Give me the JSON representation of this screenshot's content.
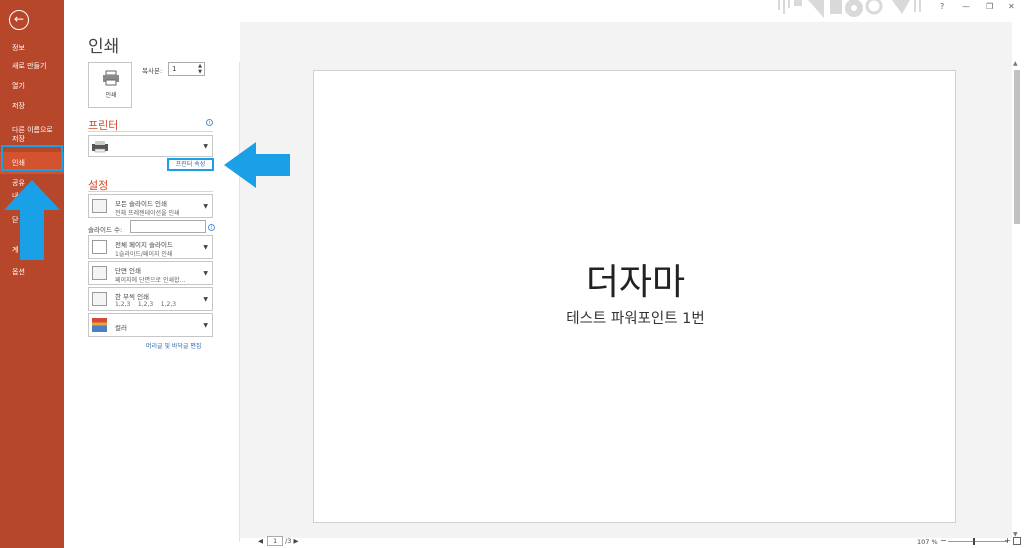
{
  "sidebar": {
    "back_icon": "back-arrow-icon",
    "items": [
      {
        "label": "정보"
      },
      {
        "label": "새로 만들기"
      },
      {
        "label": "열기"
      },
      {
        "label": "저장"
      },
      {
        "label": "다른 이름으로\n저장"
      },
      {
        "label": "인쇄",
        "selected": true
      },
      {
        "label": "공유"
      },
      {
        "label": "옵션"
      }
    ],
    "hidden_letters": [
      "내",
      "닫",
      "계"
    ]
  },
  "window": {
    "help": "?",
    "minimize": "—",
    "restore": "❐",
    "close": "✕"
  },
  "print": {
    "title": "인쇄",
    "print_button_label": "인쇄",
    "copies_label": "복사본:",
    "copies_value": "1",
    "printer_heading": "프린터",
    "printer_properties": "프린터 속성",
    "settings_heading": "설정",
    "settings": [
      {
        "main": "모든 슬라이드 인쇄",
        "sub": "전체 프레젠테이션을 인쇄"
      },
      {
        "main": "전체 페이지 슬라이드",
        "sub": "1슬라이드/페이지 인쇄"
      },
      {
        "main": "단면 인쇄",
        "sub": "페이지에 단면으로 인쇄합..."
      },
      {
        "main": "한 부씩 인쇄",
        "sub": "1,2,3    1,2,3    1,2,3"
      },
      {
        "main": "컬러",
        "sub": ""
      }
    ],
    "slides_label": "슬라이드 수:",
    "slides_value": "",
    "header_footer_link": "머리글 및 바닥글 편집"
  },
  "preview": {
    "slide_title": "더자마",
    "slide_subtitle": "테스트 파워포인트 1번"
  },
  "footer": {
    "prev": "◀",
    "page_value": "1",
    "page_total": "/3",
    "next": "▶",
    "zoom": "107 %",
    "zoom_minus": "−",
    "zoom_plus": "+"
  },
  "colors": {
    "sidebar": "#b7472a",
    "selected": "#d35230",
    "heading": "#d04a2c",
    "callout": "#1aa0e6"
  }
}
